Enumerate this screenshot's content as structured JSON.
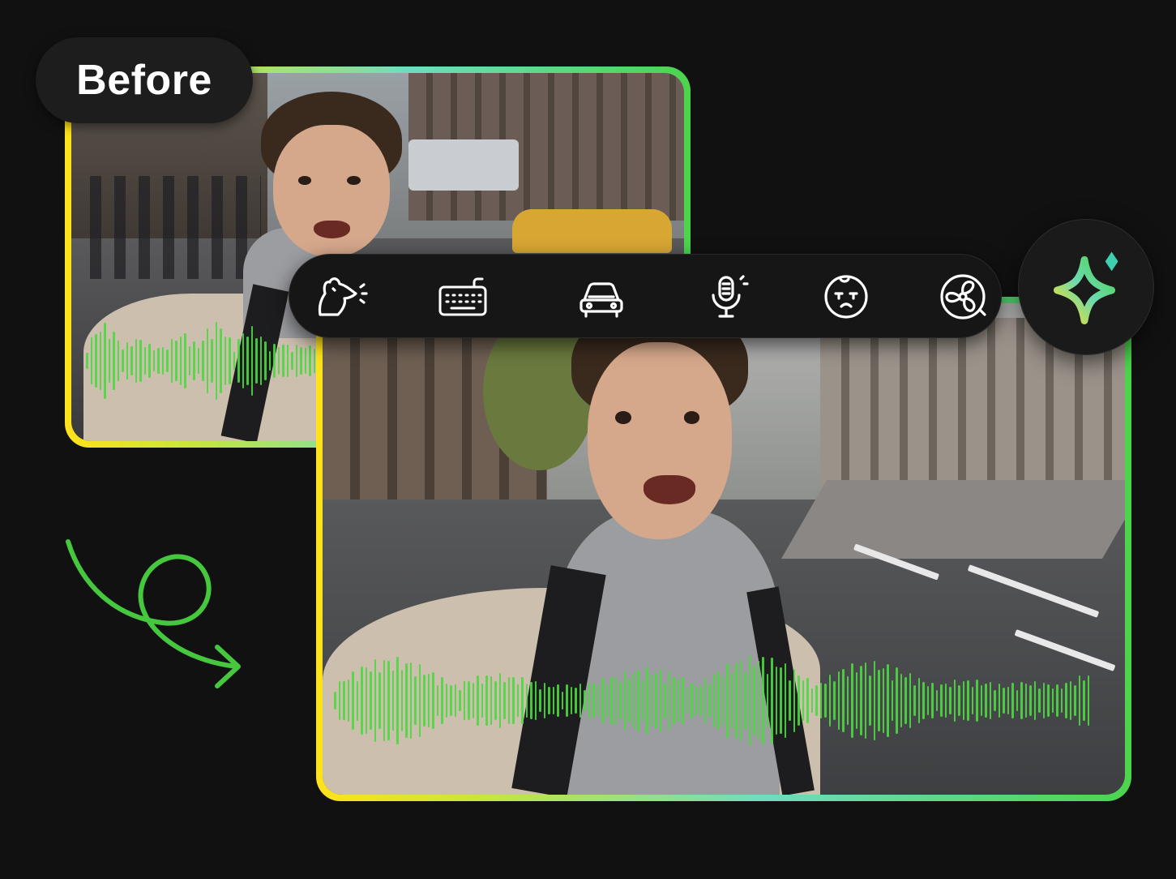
{
  "badge": {
    "label": "Before"
  },
  "toolbar": {
    "tools": [
      {
        "icon": "animal-sound-icon"
      },
      {
        "icon": "keyboard-icon"
      },
      {
        "icon": "car-icon"
      },
      {
        "icon": "microphone-icon"
      },
      {
        "icon": "crying-baby-icon"
      },
      {
        "icon": "fan-icon"
      }
    ]
  },
  "ai_button": {
    "icon": "sparkle-icon"
  },
  "colors": {
    "background": "#111111",
    "waveform": "#4cd840",
    "frame_gradient": [
      "#ffe21a",
      "#6fdcc0",
      "#4cd44c"
    ],
    "icon_stroke": "#ffffff",
    "sparkle_accent": "#3ecfb0"
  }
}
